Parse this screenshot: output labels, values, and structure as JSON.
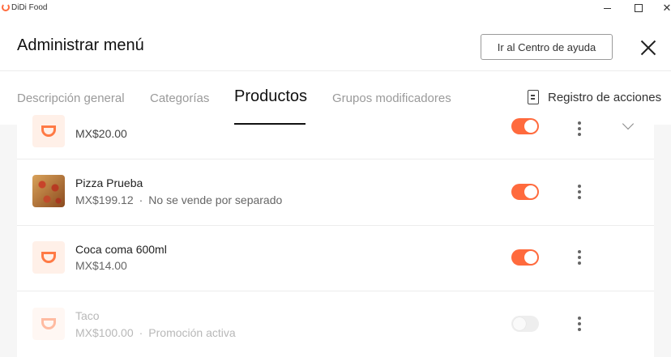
{
  "window": {
    "app_name": "DiDi Food"
  },
  "header": {
    "title": "Administrar menú",
    "help_button": "Ir al Centro de ayuda"
  },
  "tabs": [
    {
      "label": "Descripción general",
      "active": false
    },
    {
      "label": "Categorías",
      "active": false
    },
    {
      "label": "Productos",
      "active": true
    },
    {
      "label": "Grupos modificadores",
      "active": false
    }
  ],
  "action_log": {
    "label": "Registro de acciones",
    "icon": "document-icon"
  },
  "products": [
    {
      "name": "",
      "price": "MX$20.00",
      "note": "",
      "enabled": true,
      "thumbnail": "didi-logo"
    },
    {
      "name": "Pizza Prueba",
      "price": "MX$199.12",
      "note": "No se vende por separado",
      "enabled": true,
      "thumbnail": "pizza-photo"
    },
    {
      "name": "Coca coma 600ml",
      "price": "MX$14.00",
      "note": "",
      "enabled": true,
      "thumbnail": "didi-logo"
    },
    {
      "name": "Taco",
      "price": "MX$100.00",
      "note": "Promoción activa",
      "enabled": false,
      "thumbnail": "didi-logo"
    }
  ],
  "separator": "·",
  "colors": {
    "accent": "#ff6a3d",
    "list_background": "#f6f6f6"
  }
}
